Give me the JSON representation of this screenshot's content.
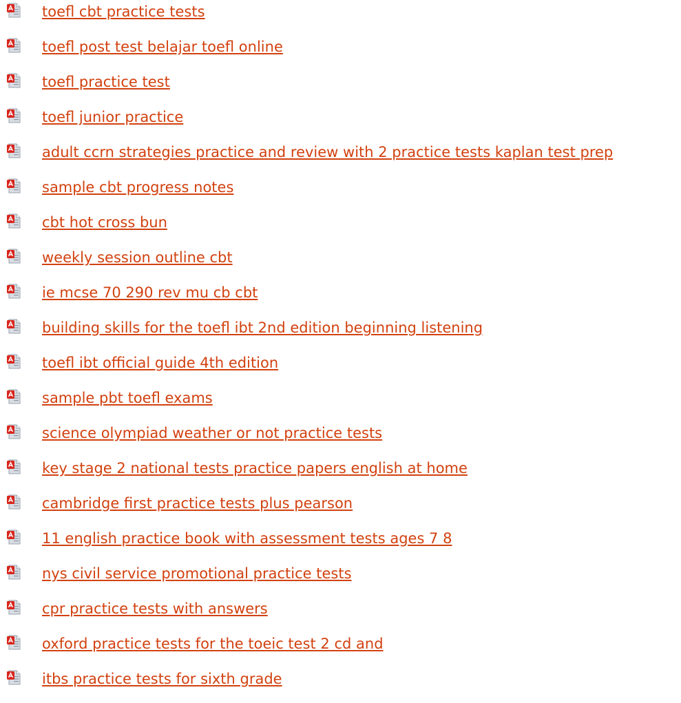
{
  "colors": {
    "link": "#d2410f",
    "icon_red": "#d8261d",
    "icon_page": "#d9dde3",
    "background": "#ffffff"
  },
  "icon_name": "pdf-file-icon",
  "results": [
    {
      "label": "toefl cbt practice tests"
    },
    {
      "label": "toefl post test belajar toefl online"
    },
    {
      "label": "toefl practice test"
    },
    {
      "label": "toefl junior practice"
    },
    {
      "label": "adult ccrn strategies practice and review with 2 practice tests kaplan test prep"
    },
    {
      "label": "sample cbt progress notes"
    },
    {
      "label": "cbt hot cross bun"
    },
    {
      "label": "weekly session outline cbt"
    },
    {
      "label": "ie mcse 70 290 rev mu cb cbt"
    },
    {
      "label": "building skills for the toefl ibt 2nd edition beginning listening"
    },
    {
      "label": "toefl ibt official guide 4th edition"
    },
    {
      "label": "sample pbt toefl exams"
    },
    {
      "label": "science olympiad weather or not practice tests"
    },
    {
      "label": "key stage 2 national tests practice papers english at home"
    },
    {
      "label": "cambridge first practice tests plus pearson"
    },
    {
      "label": "11 english practice book with assessment tests ages 7 8"
    },
    {
      "label": "nys civil service promotional practice tests"
    },
    {
      "label": "cpr practice tests with answers"
    },
    {
      "label": "oxford practice tests for the toeic test 2 cd and"
    },
    {
      "label": "itbs practice tests for sixth grade"
    }
  ]
}
